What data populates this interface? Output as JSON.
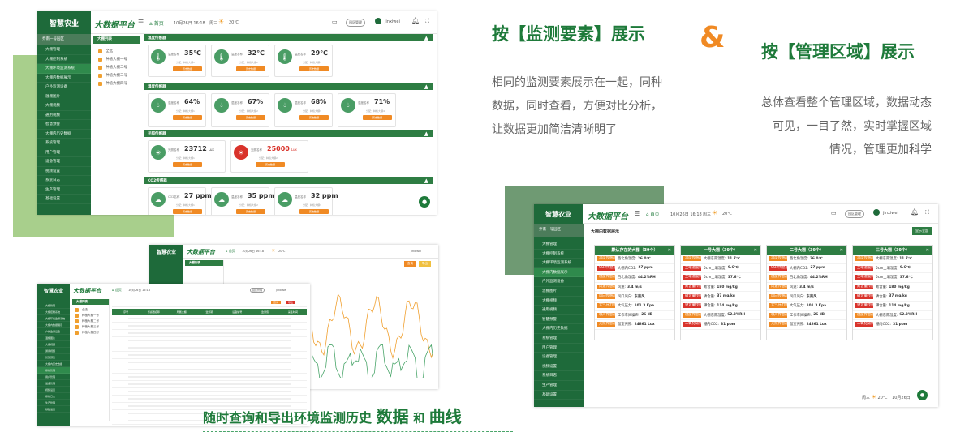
{
  "logo": {
    "text": "智慧农业"
  },
  "platform": {
    "brand": "大数据平台"
  },
  "topbar": {
    "home_label": "首页",
    "datetime": "10月26日 16:18",
    "weekday": "周三",
    "temperature": "20℃",
    "user": "jinxiwei",
    "notif_count": "3",
    "env_button": "园区管理"
  },
  "campus": {
    "name": "乔南一号园区"
  },
  "sidebar_main": [
    "大棚管理",
    "大棚控制系统",
    "大棚环境监测系统",
    "大棚内数据展示",
    "户外监测设备",
    "温棚图片",
    "大棚视频",
    "通用视频",
    "智慧预警",
    "大棚内历史数据",
    "系统管理",
    "用户管理",
    "设备管理",
    "视频设置",
    "系统日志",
    "生产管理",
    "基础设置"
  ],
  "tree": {
    "title": "大棚列表",
    "items": [
      "全选",
      "种植大棚一号",
      "种植大棚二号",
      "种植大棚三号",
      "种植大棚四号"
    ]
  },
  "panels": {
    "temperature": {
      "title": "温度传感器",
      "cards": [
        {
          "label": "温度名称",
          "value": "35℃",
          "sub": "分配：种植大棚1",
          "btn": "历史数据"
        },
        {
          "label": "温度名称",
          "value": "32℃",
          "sub": "分配：种植大棚2",
          "btn": "历史数据"
        },
        {
          "label": "温度名称",
          "value": "29℃",
          "sub": "分配：种植大棚3",
          "btn": "历史数据"
        }
      ]
    },
    "humidity": {
      "title": "湿度传感器",
      "cards": [
        {
          "label": "湿度名称",
          "value": "64%",
          "sub": "分配：种植大棚1",
          "btn": "历史数据"
        },
        {
          "label": "湿度名称",
          "value": "67%",
          "sub": "分配：种植大棚2",
          "btn": "历史数据"
        },
        {
          "label": "湿度名称",
          "value": "68%",
          "sub": "分配：种植大棚3",
          "btn": "历史数据"
        },
        {
          "label": "湿度名称",
          "value": "71%",
          "sub": "分配：种植大棚4",
          "btn": "历史数据"
        }
      ]
    },
    "light": {
      "title": "光照传感器",
      "cards": [
        {
          "label": "光照名称",
          "value": "23712",
          "unit": "Lux",
          "sub": "分配：种植大棚1",
          "btn": "历史数据"
        },
        {
          "label": "光照名称",
          "value": "25000",
          "unit": "Lux",
          "sub": "分配：种植大棚2",
          "btn": "历史数据"
        }
      ]
    },
    "co2": {
      "title": "CO2传感器",
      "cards": [
        {
          "label": "CO2名称",
          "value": "27 ppm",
          "sub": "分配：种植大棚1",
          "btn": "历史数据"
        },
        {
          "label": "温度名称",
          "value": "35 ppm",
          "sub": "分配：种植大棚2",
          "btn": "历史数据"
        },
        {
          "label": "温度名称",
          "value": "32 ppm",
          "sub": "分配：种植大棚3",
          "btn": "历史数据"
        }
      ]
    }
  },
  "marketing": {
    "heading_left": "按【监测要素】展示",
    "amp": "&",
    "heading_right": "按【管理区域】展示",
    "desc_left": [
      "相同的监测要素展示在一起，同种",
      "数据，同时查看，方便对比分析，",
      "让数据更加简洁清晰明了"
    ],
    "desc_right": [
      "总体查看整个管理区域，数据动态",
      "可见，一目了然，实时掌握区域",
      "情况，管理更加科学"
    ],
    "bottom_caption": "随时查询和导出环境监测历史",
    "bottom_word1": "数据",
    "bottom_and": "和",
    "bottom_word2": "曲线"
  },
  "area_view": {
    "title": "大棚内数据展示",
    "button": "显示全部",
    "footer_weekday": "周三",
    "footer_temp": "20℃",
    "footer_date": "10月26日",
    "columns": [
      {
        "name": "默认存在的大棚（39个）",
        "rows": [
          {
            "tag": "温度传感器",
            "text": "西北角温度:",
            "value": "26.0℃"
          },
          {
            "tag": "CO2传感器",
            "text": "大棚内CO2:",
            "value": "27 ppm"
          },
          {
            "tag": "湿度传感器",
            "text": "西北角湿度:",
            "value": "44.2%RH"
          },
          {
            "tag": "风速传感器",
            "text": "风速:",
            "value": "3.4 m/s"
          },
          {
            "tag": "风向传感器",
            "text": "风口风向:",
            "value": "东南风"
          },
          {
            "tag": "大气压力传感器",
            "text": "大气压力:",
            "value": "101.3 Kpa"
          },
          {
            "tag": "噪声传感器",
            "text": "工作车间噪声:",
            "value": "26 dB"
          },
          {
            "tag": "光照传感器",
            "text": "温室光照:",
            "value": "24861 Lux"
          }
        ]
      },
      {
        "name": "一号大棚（39个）",
        "rows": [
          {
            "tag": "温度传感器",
            "text": "大棚东南温度:",
            "value": "11.7℃"
          },
          {
            "tag": "土壤温度传感器",
            "text": "5cm土壤温度:",
            "value": "9.6℃"
          },
          {
            "tag": "土壤湿度传感器",
            "text": "5cm土壤湿度:",
            "value": "37.6℃"
          },
          {
            "tag": "氮含量传感器",
            "text": "氮含量:",
            "value": "180 mg/kg"
          },
          {
            "tag": "磷含量传感器",
            "text": "磷含量:",
            "value": "37 mg/kg"
          },
          {
            "tag": "钾含量传感器",
            "text": "钾含量:",
            "value": "114 mg/kg"
          },
          {
            "tag": "湿度传感器",
            "text": "大棚东南湿度:",
            "value": "62.3%RH"
          },
          {
            "tag": "二氧化碳传感器",
            "text": "棚内CO2:",
            "value": "31 ppm"
          }
        ]
      },
      {
        "name": "二号大棚（39个）",
        "rows": [
          {
            "tag": "温度传感器",
            "text": "西北角温度:",
            "value": "26.0℃"
          },
          {
            "tag": "CO2传感器",
            "text": "大棚内CO2:",
            "value": "27 ppm"
          },
          {
            "tag": "湿度传感器",
            "text": "西北角湿度:",
            "value": "44.2%RH"
          },
          {
            "tag": "风速传感器",
            "text": "风速:",
            "value": "3.4 m/s"
          },
          {
            "tag": "风向传感器",
            "text": "风口风向:",
            "value": "东南风"
          },
          {
            "tag": "大气压力传感器",
            "text": "大气压力:",
            "value": "101.3 Kpa"
          },
          {
            "tag": "噪声传感器",
            "text": "工作车间噪声:",
            "value": "26 dB"
          },
          {
            "tag": "光照传感器",
            "text": "温室光照:",
            "value": "24861 Lux"
          }
        ]
      },
      {
        "name": "三号大棚（39个）",
        "rows": [
          {
            "tag": "温度传感器",
            "text": "大棚东南温度:",
            "value": "11.7℃"
          },
          {
            "tag": "土壤温度传感器",
            "text": "5cm土壤温度:",
            "value": "9.6℃"
          },
          {
            "tag": "土壤湿度传感器",
            "text": "5cm土壤湿度:",
            "value": "37.6℃"
          },
          {
            "tag": "氮含量传感器",
            "text": "氮含量:",
            "value": "180 mg/kg"
          },
          {
            "tag": "磷含量传感器",
            "text": "磷含量:",
            "value": "37 mg/kg"
          },
          {
            "tag": "钾含量传感器",
            "text": "钾含量:",
            "value": "114 mg/kg"
          },
          {
            "tag": "湿度传感器",
            "text": "大棚东南湿度:",
            "value": "62.3%RH"
          },
          {
            "tag": "二氧化碳传感器",
            "text": "棚内CO2:",
            "value": "31 ppm"
          }
        ]
      }
    ]
  },
  "history_view": {
    "tree_title": "大棚列表",
    "tree_items": [
      "全选",
      "种植大棚一号",
      "种植大棚二号",
      "种植大棚三号",
      "种植大棚四号"
    ],
    "query_button": "查询",
    "export_button": "导出",
    "table_headers": [
      "序号",
      "传感器名称",
      "所属大棚",
      "监测项",
      "设备编号",
      "监测值",
      "采集时间"
    ],
    "colors": {
      "series1": "#f0a030",
      "series2": "#4aa56a"
    }
  }
}
